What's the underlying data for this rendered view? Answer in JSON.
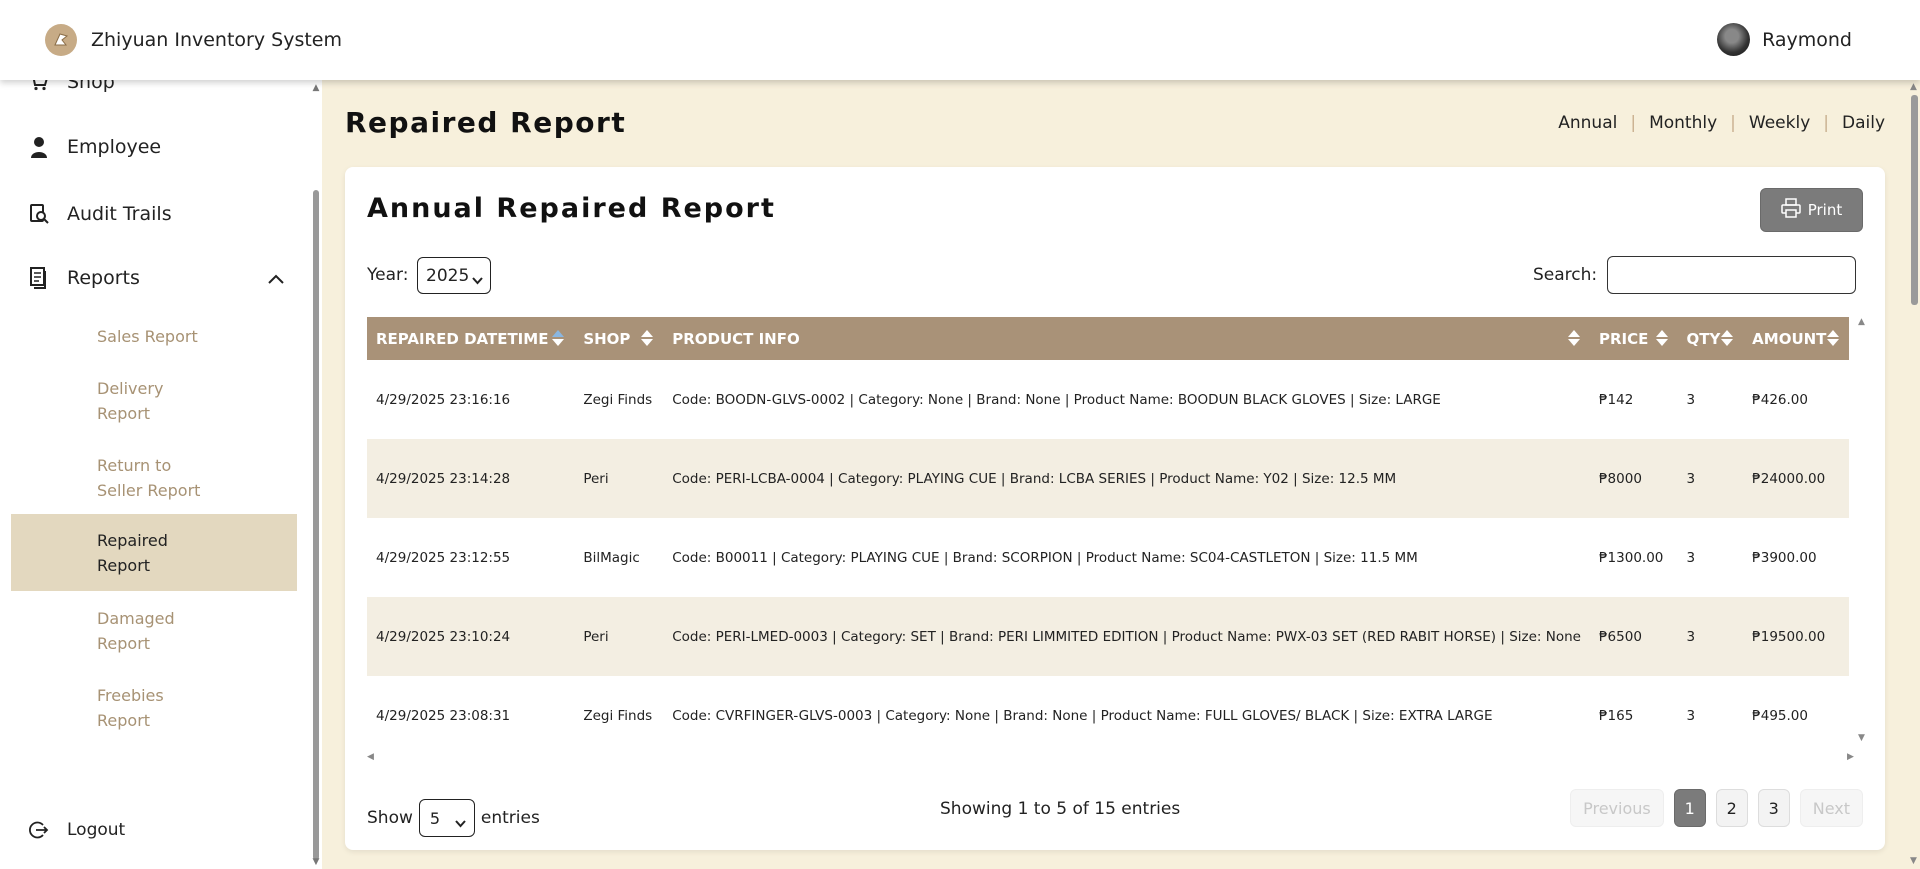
{
  "app": {
    "title": "Zhiyuan Inventory System",
    "user": "Raymond"
  },
  "sidebar": {
    "items": [
      {
        "label": "Shop",
        "icon": "shop-icon"
      },
      {
        "label": "Employee",
        "icon": "person-icon"
      },
      {
        "label": "Audit Trails",
        "icon": "audit-icon"
      },
      {
        "label": "Reports",
        "icon": "report-icon"
      }
    ],
    "reports_sub": [
      {
        "label": "Sales Report"
      },
      {
        "label": "Delivery Report"
      },
      {
        "label": "Return to Seller Report"
      },
      {
        "label": "Repaired Report"
      },
      {
        "label": "Damaged Report"
      },
      {
        "label": "Freebies Report"
      }
    ],
    "logout": "Logout"
  },
  "header": {
    "title": "Repaired Report",
    "periods": [
      "Annual",
      "Monthly",
      "Weekly",
      "Daily"
    ]
  },
  "card": {
    "title": "Annual Repaired Report",
    "print_label": "Print",
    "year_label": "Year:",
    "year_value": "2025",
    "search_label": "Search:",
    "search_value": ""
  },
  "table": {
    "columns": [
      "REPAIRED DATETIME",
      "SHOP",
      "PRODUCT INFO",
      "PRICE",
      "QTY",
      "AMOUNT"
    ],
    "rows": [
      [
        "4/29/2025 23:16:16",
        "Zegi Finds",
        "Code: BOODN-GLVS-0002 | Category: None | Brand: None | Product Name: BOODUN BLACK GLOVES | Size: LARGE",
        "₱142",
        "3",
        "₱426.00"
      ],
      [
        "4/29/2025 23:14:28",
        "Peri",
        "Code: PERI-LCBA-0004 | Category: PLAYING CUE | Brand: LCBA SERIES | Product Name: Y02 | Size: 12.5 MM",
        "₱8000",
        "3",
        "₱24000.00"
      ],
      [
        "4/29/2025 23:12:55",
        "BilMagic",
        "Code: B00011 | Category: PLAYING CUE | Brand: SCORPION | Product Name: SC04-CASTLETON | Size: 11.5 MM",
        "₱1300.00",
        "3",
        "₱3900.00"
      ],
      [
        "4/29/2025 23:10:24",
        "Peri",
        "Code: PERI-LMED-0003 | Category: SET | Brand: PERI LIMMITED EDITION | Product Name: PWX-03 SET (RED RABIT HORSE) | Size: None",
        "₱6500",
        "3",
        "₱19500.00"
      ],
      [
        "4/29/2025 23:08:31",
        "Zegi Finds",
        "Code: CVRFINGER-GLVS-0003 | Category: None | Brand: None | Product Name: FULL GLOVES/ BLACK | Size: EXTRA LARGE",
        "₱165",
        "3",
        "₱495.00"
      ]
    ]
  },
  "footer": {
    "show_label": "Show",
    "show_value": "5",
    "entries_label": "entries",
    "info": "Showing 1 to 5 of 15 entries",
    "previous": "Previous",
    "pages": [
      "1",
      "2",
      "3"
    ],
    "next": "Next"
  }
}
